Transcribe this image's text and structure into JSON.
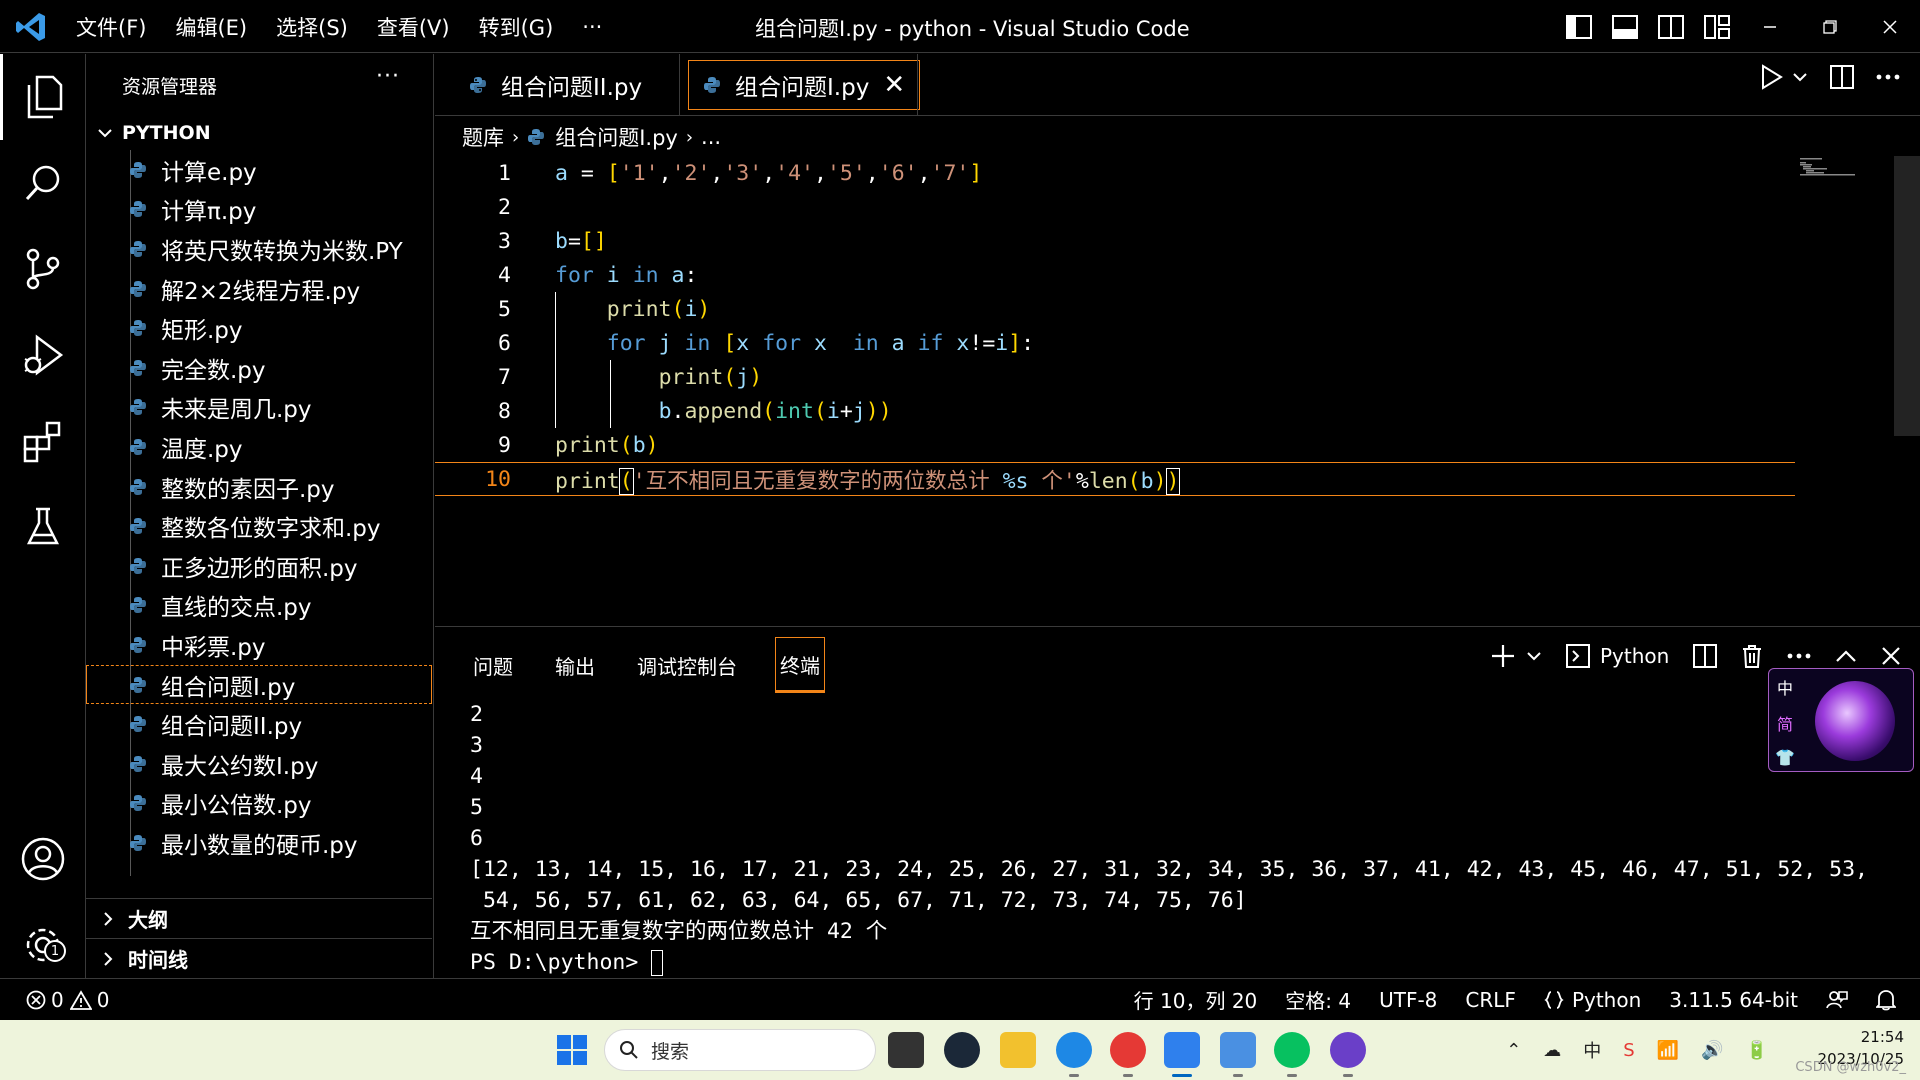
{
  "titlebar": {
    "menus": [
      "文件(F)",
      "编辑(E)",
      "选择(S)",
      "查看(V)",
      "转到(G)",
      "···"
    ],
    "title": "组合问题I.py - python - Visual Studio Code"
  },
  "sidebar": {
    "header": "资源管理器",
    "more": "···",
    "folder": "PYTHON",
    "files": [
      "计算e.py",
      "计算π.py",
      "将英尺数转换为米数.PY",
      "解2×2线程方程.py",
      "矩形.py",
      "完全数.py",
      "未来是周几.py",
      "温度.py",
      "整数的素因子.py",
      "整数各位数字求和.py",
      "正多边形的面积.py",
      "直线的交点.py",
      "中彩票.py",
      "组合问题I.py",
      "组合问题II.py",
      "最大公约数I.py",
      "最小公倍数.py",
      "最小数量的硬币.py"
    ],
    "selected_file": "组合问题I.py",
    "outline": "大纲",
    "timeline": "时间线"
  },
  "tabs": [
    {
      "label": "组合问题II.py"
    },
    {
      "label": "组合问题I.py",
      "close": "✕"
    }
  ],
  "breadcrumb": {
    "folder": "题库",
    "file": "组合问题I.py",
    "more": "..."
  },
  "editor": {
    "line_numbers": [
      "1",
      "2",
      "3",
      "4",
      "5",
      "6",
      "7",
      "8",
      "9",
      "10"
    ],
    "current_line": "10"
  },
  "panel": {
    "tabs": [
      "问题",
      "输出",
      "调试控制台",
      "终端"
    ],
    "active_tab": "终端",
    "terminal_profile": "Python",
    "terminal_lines": [
      "2",
      "3",
      "4",
      "5",
      "6",
      "[12, 13, 14, 15, 16, 17, 21, 23, 24, 25, 26, 27, 31, 32, 34, 35, 36, 37, 41, 42, 43, 45, 46, 47, 51, 52, 53,",
      " 54, 56, 57, 61, 62, 63, 64, 65, 67, 71, 72, 73, 74, 75, 76]",
      "互不相同且无重复数字的两位数总计 42 个"
    ],
    "prompt": "PS D:\\python> "
  },
  "ime": {
    "lang": "中",
    "mode": "简"
  },
  "statusbar": {
    "errors": "0",
    "warnings": "0",
    "position": "行 10，列 20",
    "spaces": "空格: 4",
    "encoding": "UTF-8",
    "eol": "CRLF",
    "language": "Python",
    "interpreter": "3.11.5 64-bit"
  },
  "taskbar": {
    "search_placeholder": "搜索",
    "time": "21:54",
    "date": "2023/10/25",
    "watermark": "CSDN @wzh0v2_",
    "ime_indicator": "中"
  },
  "colors": {
    "accent_border": "#f38518",
    "keyword": "#569cd6",
    "string": "#ce9178",
    "function": "#dcdcaa",
    "variable": "#9cdcfe",
    "builtin": "#4ec9b0",
    "bracket": "#ffd700"
  }
}
